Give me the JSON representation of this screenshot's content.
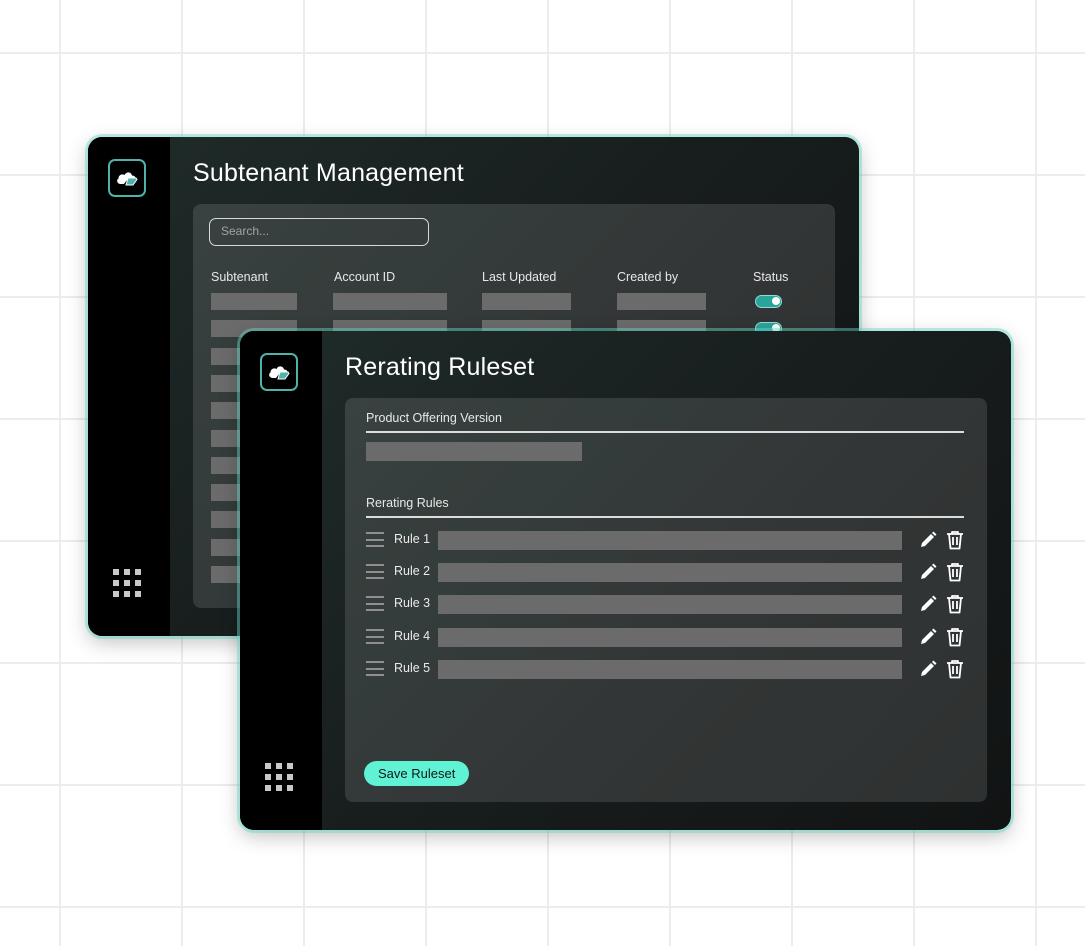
{
  "back_window": {
    "title": "Subtenant Management",
    "search_placeholder": "Search...",
    "columns": [
      "Subtenant",
      "Account ID",
      "Last Updated",
      "Created by",
      "Status"
    ],
    "row_count": 11,
    "visible_status_toggles": 2
  },
  "front_window": {
    "title": "Rerating Ruleset",
    "product_offering_label": "Product Offering Version",
    "rerating_rules_label": "Rerating Rules",
    "rules": [
      {
        "label": "Rule 1"
      },
      {
        "label": "Rule 2"
      },
      {
        "label": "Rule 3"
      },
      {
        "label": "Rule 4"
      },
      {
        "label": "Rule 5"
      }
    ],
    "save_label": "Save Ruleset"
  },
  "icons": {
    "logo": "cloud-tag-icon",
    "app_grid": "app-grid-icon",
    "drag": "drag-handle-icon",
    "edit": "pencil-icon",
    "delete": "trash-icon"
  },
  "colors": {
    "accent": "#5ff2d5",
    "toggle_on": "#2aa39b",
    "logo_border": "#4fb3ab"
  }
}
